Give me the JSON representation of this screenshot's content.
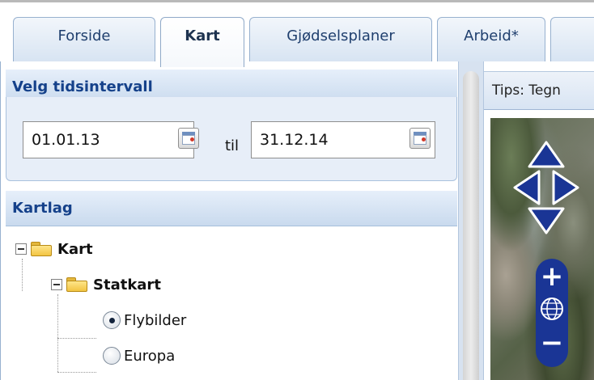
{
  "tabs": [
    {
      "label": "Forside",
      "active": false
    },
    {
      "label": "Kart",
      "active": true
    },
    {
      "label": "Gjødselsplaner",
      "active": false
    },
    {
      "label": "Arbeid*",
      "active": false
    },
    {
      "label": "",
      "active": false
    }
  ],
  "time_interval": {
    "header": "Velg tidsintervall",
    "from_value": "01.01.13",
    "to_label": "til",
    "to_value": "31.12.14"
  },
  "layers": {
    "header": "Kartlag",
    "root": {
      "label": "Kart"
    },
    "group": {
      "label": "Statkart"
    },
    "options": [
      {
        "label": "Flybilder",
        "checked": true
      },
      {
        "label": "Europa",
        "checked": false
      }
    ]
  },
  "map": {
    "tips_text": "Tips: Tegn",
    "zoom_in_glyph": "+",
    "zoom_out_glyph": "−",
    "nav_color": "#1a3595"
  },
  "colors": {
    "header_text": "#15418a",
    "tab_border": "#97b1cf"
  }
}
